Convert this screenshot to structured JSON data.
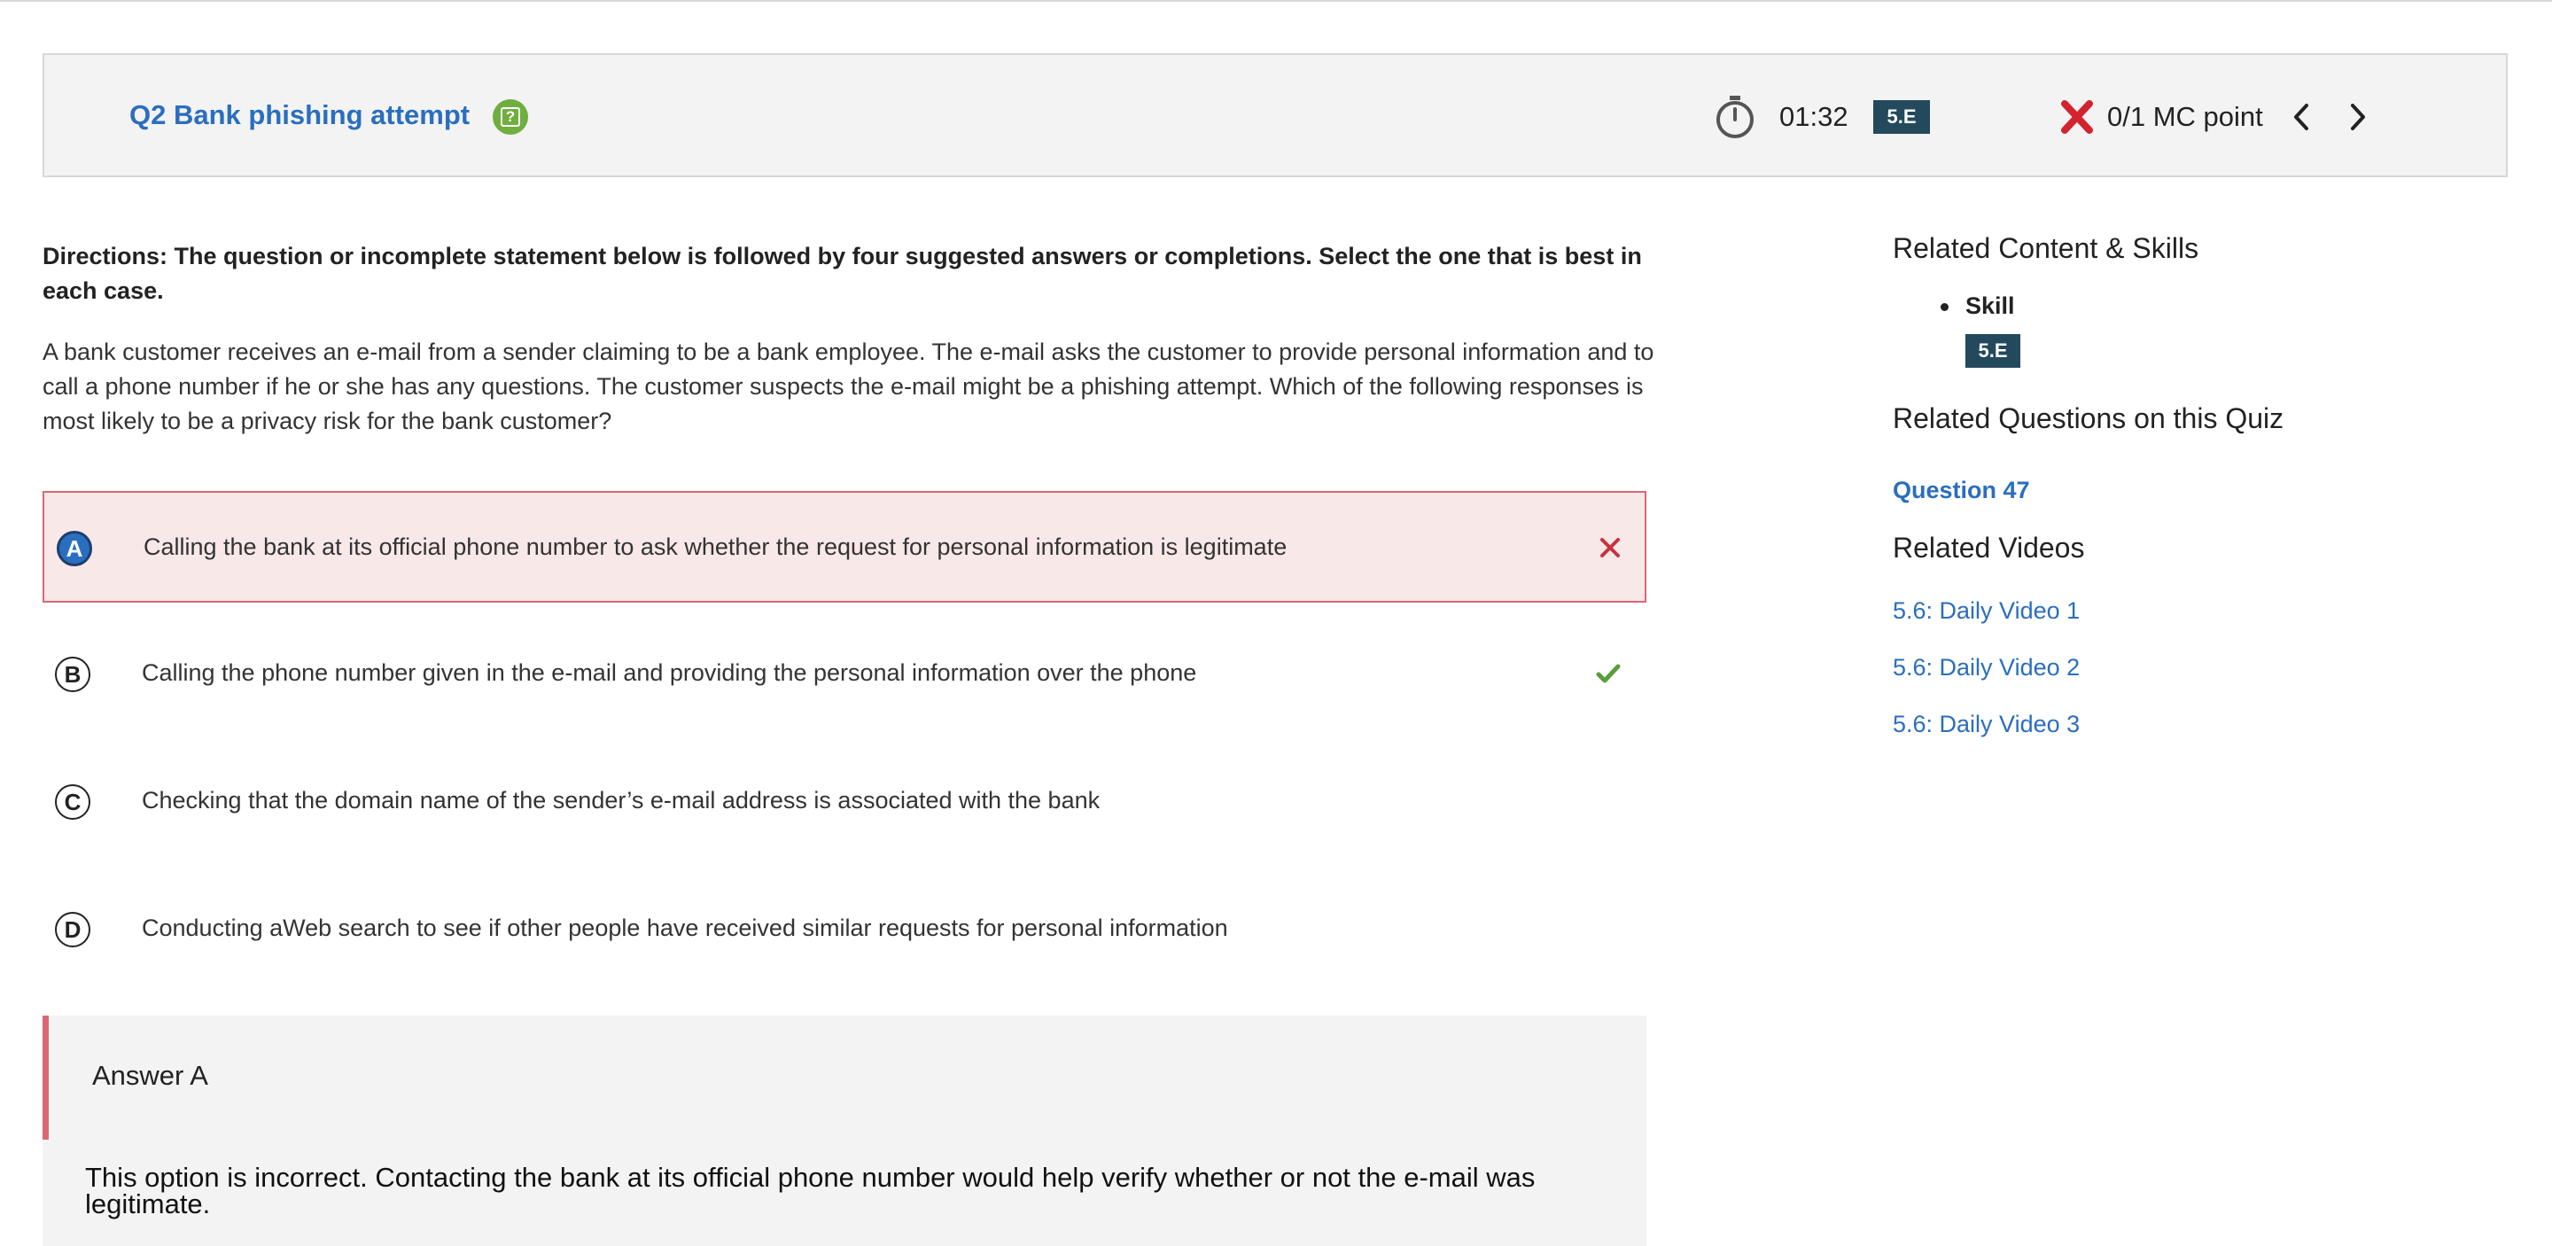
{
  "header": {
    "title": "Q2 Bank phishing attempt",
    "help_icon": "question-square-icon",
    "timer_icon": "stopwatch-icon",
    "timer": "01:32",
    "skill_badge": "5.E",
    "result_icon": "red-x-icon",
    "score": "0/1 MC point",
    "prev_icon": "chevron-left-icon",
    "next_icon": "chevron-right-icon"
  },
  "question": {
    "directions": "Directions: The question or incomplete statement below is followed by four suggested answers or completions. Select the one that is best in each case.",
    "stem": "A bank customer receives an e-mail from a sender claiming to be a bank employee. The e-mail asks the customer to provide personal information and to call a phone number if he or she has any questions. The customer suspects the e-mail might be a phishing attempt. Which of the following responses is most likely to be a privacy risk for the bank customer?",
    "options": [
      {
        "letter": "A",
        "text": "Calling the bank at its official phone number to ask whether the request for personal information is legitimate",
        "selected": true,
        "mark": "red-x"
      },
      {
        "letter": "B",
        "text": "Calling the phone number given in the e-mail and providing the personal information over the phone",
        "selected": false,
        "mark": "green-check"
      },
      {
        "letter": "C",
        "text": "Checking that the domain name of the sender’s e-mail address is associated with the bank",
        "selected": false,
        "mark": ""
      },
      {
        "letter": "D",
        "text": "Conducting aWeb search to see if other people have received similar requests for personal information",
        "selected": false,
        "mark": ""
      }
    ]
  },
  "answer": {
    "title": "Answer A",
    "explanation": "This option is incorrect. Contacting the bank at its official phone number would help verify whether or not the e-mail was legitimate."
  },
  "sidebar": {
    "related_content_heading": "Related Content & Skills",
    "skill_label": "Skill",
    "skill_badge": "5.E",
    "related_questions_heading": "Related Questions on this Quiz",
    "related_questions": [
      "Question 47"
    ],
    "related_videos_heading": "Related Videos",
    "related_videos": [
      "5.6: Daily Video 1",
      "5.6: Daily Video 2",
      "5.6: Daily Video 3"
    ]
  },
  "colors": {
    "link_blue": "#2a6ebf",
    "badge_teal": "#23495c",
    "incorrect_red": "#dc6673",
    "correct_green": "#5a9e3c",
    "help_green": "#6fae3f"
  }
}
